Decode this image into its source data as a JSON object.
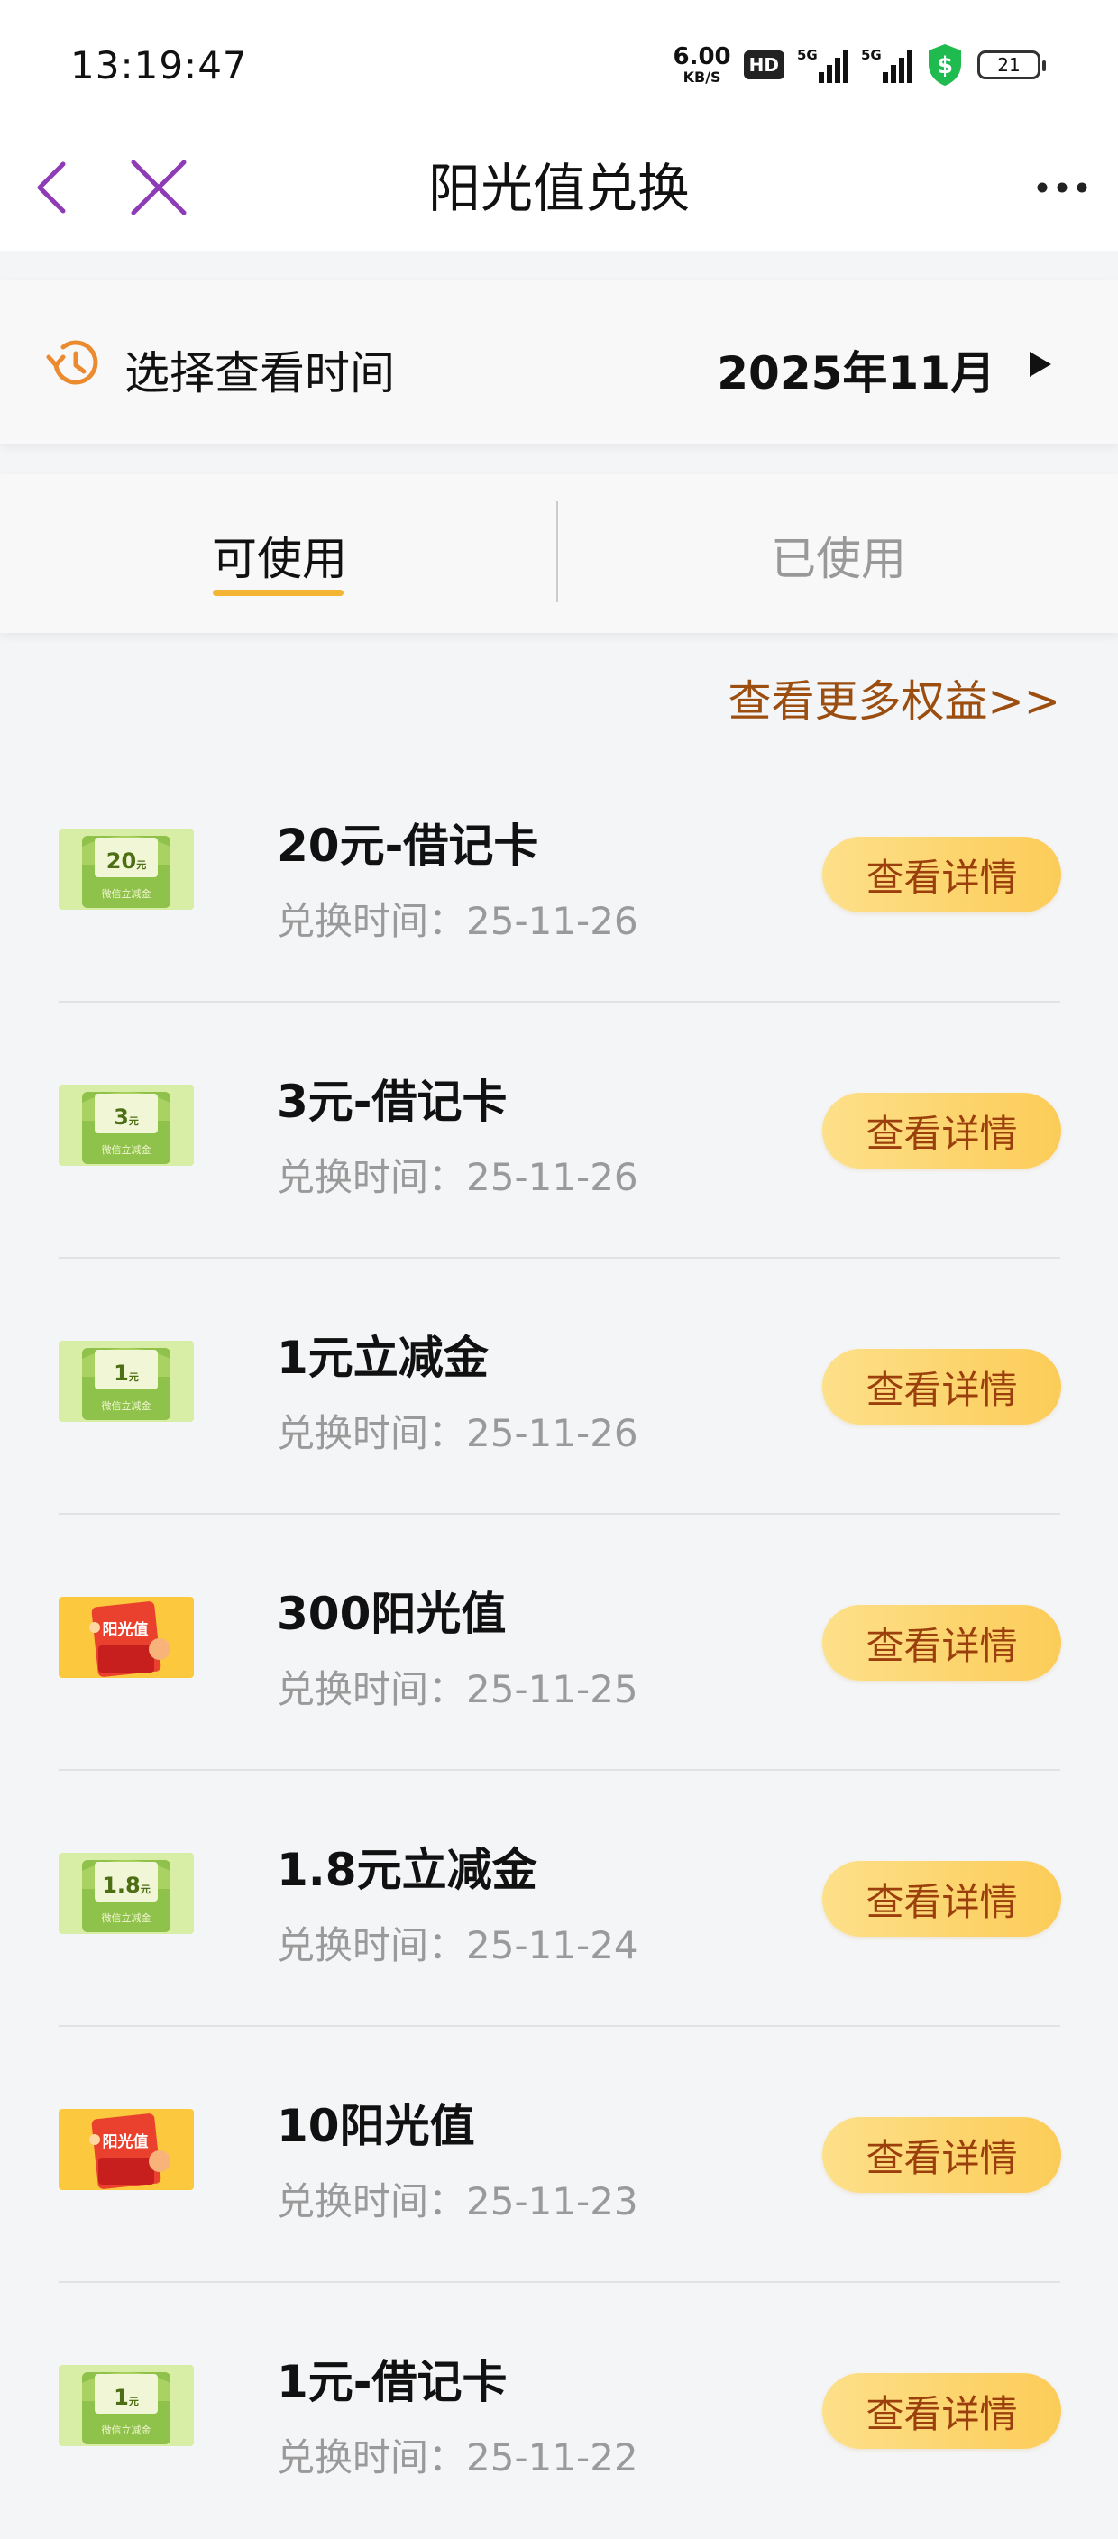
{
  "status_bar": {
    "time": "13:19:47",
    "net_speed_value": "6.00",
    "net_speed_unit": "KB/S",
    "hd_label": "HD",
    "sim1_tag": "5G",
    "sim2_tag": "5G",
    "battery_level": "21"
  },
  "header": {
    "title": "阳光值兑换",
    "back_icon": "back-arrow",
    "close_icon": "close-x",
    "more_icon": "more-dots"
  },
  "period_selector": {
    "label": "选择查看时间",
    "value": "2025年11月",
    "icon": "history-clock"
  },
  "tabs": [
    {
      "label": "可使用",
      "active": true
    },
    {
      "label": "已使用",
      "active": false
    }
  ],
  "more_benefits_link": "查看更多权益>>",
  "items": [
    {
      "name": "20元-借记卡",
      "time_label": "兑换时间：",
      "date": "25-11-26",
      "thumb_type": "green-envelope",
      "thumb_value": "20",
      "thumb_unit": "元",
      "thumb_caption": "微信立减金",
      "button_label": "查看详情"
    },
    {
      "name": "3元-借记卡",
      "time_label": "兑换时间：",
      "date": "25-11-26",
      "thumb_type": "green-envelope",
      "thumb_value": "3",
      "thumb_unit": "元",
      "thumb_caption": "微信立减金",
      "button_label": "查看详情"
    },
    {
      "name": "1元立减金",
      "time_label": "兑换时间：",
      "date": "25-11-26",
      "thumb_type": "green-envelope",
      "thumb_value": "1",
      "thumb_unit": "元",
      "thumb_caption": "微信立减金",
      "button_label": "查看详情"
    },
    {
      "name": "300阳光值",
      "time_label": "兑换时间：",
      "date": "25-11-25",
      "thumb_type": "red-envelope",
      "thumb_value": "阳光值",
      "thumb_unit": "",
      "thumb_caption": "",
      "button_label": "查看详情"
    },
    {
      "name": "1.8元立减金",
      "time_label": "兑换时间：",
      "date": "25-11-24",
      "thumb_type": "green-envelope",
      "thumb_value": "1.8",
      "thumb_unit": "元",
      "thumb_caption": "微信立减金",
      "button_label": "查看详情"
    },
    {
      "name": "10阳光值",
      "time_label": "兑换时间：",
      "date": "25-11-23",
      "thumb_type": "red-envelope",
      "thumb_value": "阳光值",
      "thumb_unit": "",
      "thumb_caption": "",
      "button_label": "查看详情"
    },
    {
      "name": "1元-借记卡",
      "time_label": "兑换时间：",
      "date": "25-11-22",
      "thumb_type": "green-envelope",
      "thumb_value": "1",
      "thumb_unit": "元",
      "thumb_caption": "微信立减金",
      "button_label": "查看详情"
    }
  ],
  "colors": {
    "accent_purple": "#8e3cb5",
    "tab_underline": "#f3b533",
    "button_start": "#fde08a",
    "button_end": "#fccc58",
    "button_text": "#9b3f0c",
    "link_text": "#9b4e0f",
    "shield_green": "#1fbb4f"
  }
}
